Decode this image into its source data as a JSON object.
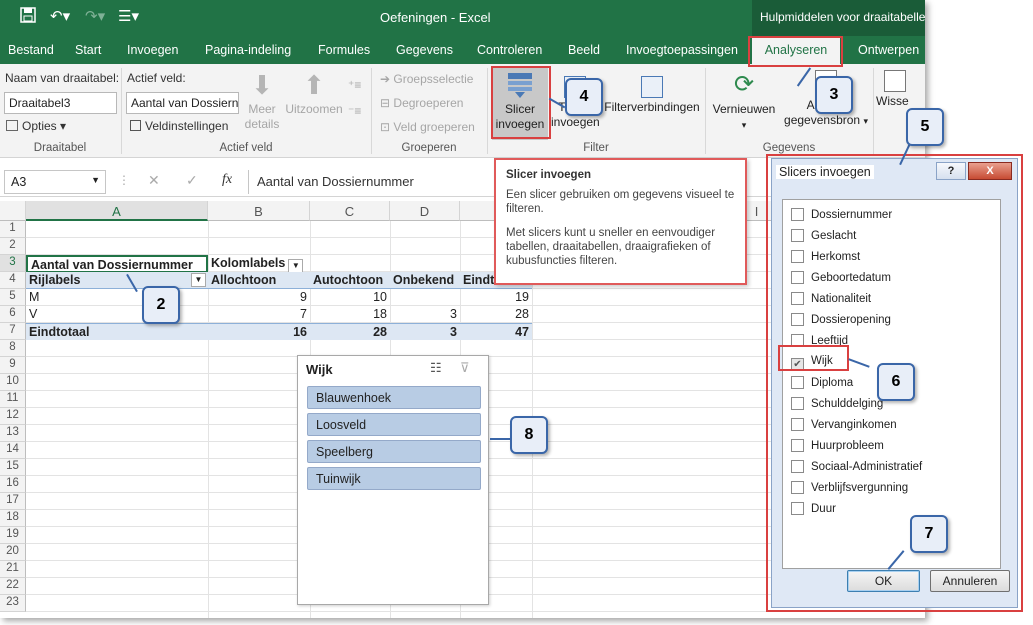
{
  "window": {
    "title": "Oefeningen - Excel",
    "context_header": "Hulpmiddelen voor draaitabellen"
  },
  "tabs": [
    "Bestand",
    "Start",
    "Invoegen",
    "Pagina-indeling",
    "Formules",
    "Gegevens",
    "Controleren",
    "Beeld",
    "Invoegtoepassingen",
    "Analyseren",
    "Ontwerpen"
  ],
  "ribbon": {
    "pivot_name_label": "Naam van draaitabel:",
    "pivot_name_value": "Draaitabel3",
    "options_label": "Opties",
    "active_field_label": "Actief veld:",
    "active_field_value": "Aantal van Dossiernu",
    "field_settings_label": "Veldinstellingen",
    "drill_down_label": "Meer details",
    "drill_up_label": "Uitzoomen",
    "group_selection": "Groepsselectie",
    "ungroup": "Degroeperen",
    "group_field": "Veld groeperen",
    "insert_slicer": "Slicer invoegen",
    "timeline": "Tijdlijn invoegen",
    "filter_connections": "Filterverbindingen",
    "refresh": "Vernieuwen",
    "change_source": "Andere gegevensbron",
    "wisse": "Wisse",
    "groups": {
      "draaitabel": "Draaitabel",
      "actief_veld": "Actief veld",
      "groeperen": "Groeperen",
      "filter": "Filter",
      "gegevens": "Gegevens"
    }
  },
  "formula_bar": {
    "cell_ref": "A3",
    "fx": "fx",
    "content": "Aantal van Dossiernummer"
  },
  "sheet": {
    "columns": [
      "A",
      "B",
      "C",
      "D",
      "I"
    ],
    "rows": [
      "1",
      "2",
      "3",
      "4",
      "5",
      "6",
      "7",
      "8",
      "9",
      "10",
      "11",
      "12",
      "13",
      "14",
      "15",
      "16",
      "17",
      "18",
      "19",
      "20",
      "21",
      "22",
      "23"
    ],
    "pivot": {
      "a3": "Aantal van Dossiernummer",
      "b3": "Kolomlabels",
      "a4": "Rijlabels",
      "b4": "Allochtoon",
      "c4": "Autochtoon",
      "d4": "Onbekend",
      "e4": "Eindt",
      "rows": [
        {
          "label": "M",
          "b": "9",
          "c": "10",
          "d": "",
          "e": "19"
        },
        {
          "label": "V",
          "b": "7",
          "c": "18",
          "d": "3",
          "e": "28"
        },
        {
          "label": "Eindtotaal",
          "b": "16",
          "c": "28",
          "d": "3",
          "e": "47"
        }
      ]
    }
  },
  "slicer": {
    "title": "Wijk",
    "items": [
      "Blauwenhoek",
      "Loosveld",
      "Speelberg",
      "Tuinwijk"
    ]
  },
  "tooltip": {
    "title": "Slicer invoegen",
    "p1": "Een slicer gebruiken om gegevens visueel te filteren.",
    "p2": "Met slicers kunt u sneller en eenvoudiger tabellen, draaitabellen, draaigrafieken of kubusfuncties filteren."
  },
  "dialog": {
    "title": "Slicers invoegen",
    "help": "?",
    "close": "X",
    "fields": [
      {
        "label": "Dossiernummer",
        "checked": false
      },
      {
        "label": "Geslacht",
        "checked": false
      },
      {
        "label": "Herkomst",
        "checked": false
      },
      {
        "label": "Geboortedatum",
        "checked": false
      },
      {
        "label": "Nationaliteit",
        "checked": false
      },
      {
        "label": "Dossieropening",
        "checked": false
      },
      {
        "label": "Leeftijd",
        "checked": false
      },
      {
        "label": "Wijk",
        "checked": true
      },
      {
        "label": "Diploma",
        "checked": false
      },
      {
        "label": "Schulddelging",
        "checked": false
      },
      {
        "label": "Vervanginkomen",
        "checked": false
      },
      {
        "label": "Huurprobleem",
        "checked": false
      },
      {
        "label": "Sociaal-Administratief",
        "checked": false
      },
      {
        "label": "Verblijfsvergunning",
        "checked": false
      },
      {
        "label": "Duur",
        "checked": false
      }
    ],
    "ok": "OK",
    "cancel": "Annuleren"
  },
  "callouts": [
    "2",
    "3",
    "4",
    "5",
    "6",
    "7",
    "8"
  ],
  "colors": {
    "excel_green": "#217346",
    "highlight_red": "#d94040",
    "slicer_item": "#b8cce4",
    "callout_border": "#3a66a8"
  }
}
